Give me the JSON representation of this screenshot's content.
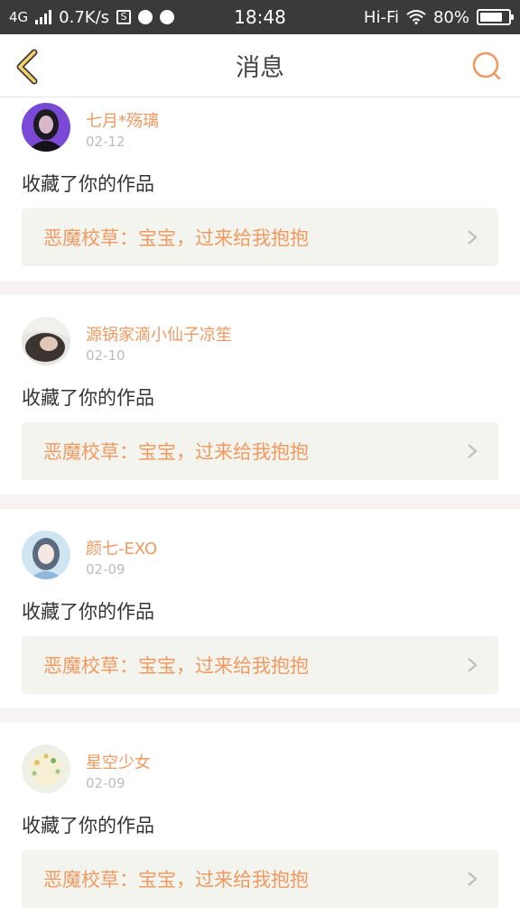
{
  "status_bar": {
    "network": "4G",
    "speed": "0.7K/s",
    "time": "18:48",
    "hifi": "Hi-Fi",
    "battery_percent": "80%",
    "battery_level": 0.8
  },
  "navbar": {
    "title": "消息",
    "accent_color": "#f09a62",
    "back_icon": "chevron-left-icon",
    "search_icon": "search-icon"
  },
  "messages": [
    {
      "username": "七月*殇璃",
      "date": "02-12",
      "action": "收藏了你的作品",
      "work_title": "恶魔校草：宝宝，过来给我抱抱"
    },
    {
      "username": "源锅家滴小仙子凉笙",
      "date": "02-10",
      "action": "收藏了你的作品",
      "work_title": "恶魔校草：宝宝，过来给我抱抱"
    },
    {
      "username": "颜七-EXO",
      "date": "02-09",
      "action": "收藏了你的作品",
      "work_title": "恶魔校草：宝宝，过来给我抱抱"
    },
    {
      "username": "星空少女",
      "date": "02-09",
      "action": "收藏了你的作品",
      "work_title": "恶魔校草：宝宝，过来给我抱抱"
    }
  ]
}
